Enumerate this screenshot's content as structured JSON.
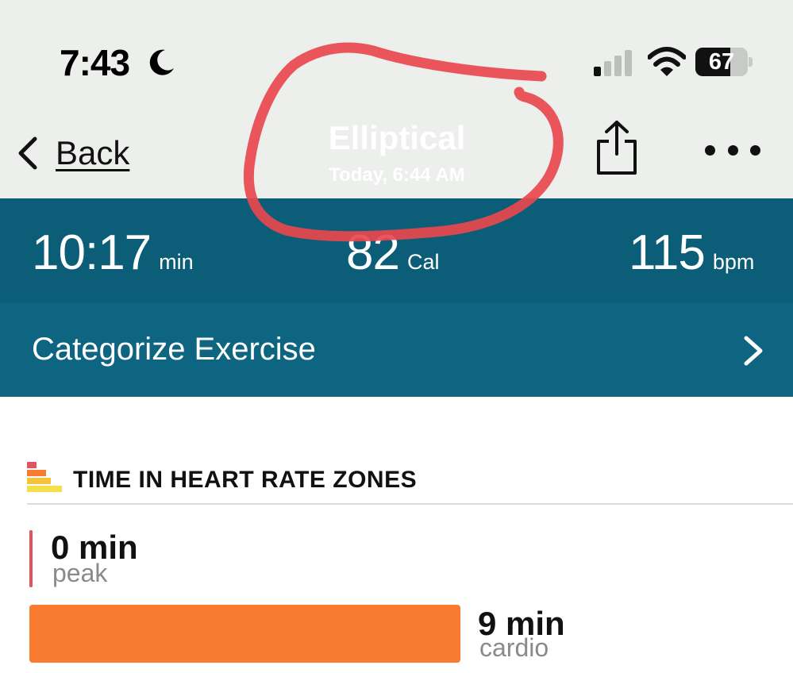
{
  "status_bar": {
    "time": "7:43",
    "focus_icon": "moon-icon",
    "signal_icon": "cellular-signal-icon",
    "wifi_icon": "wifi-icon",
    "battery_percent": "67",
    "battery_level": 0.67
  },
  "nav": {
    "back_label": "Back",
    "title": "Elliptical",
    "subtitle": "Today, 6:44 AM",
    "share_icon": "share-icon",
    "more_icon": "more-icon"
  },
  "stats": {
    "duration": {
      "value": "10:17",
      "unit": "min"
    },
    "calories": {
      "value": "82",
      "unit": "Cal"
    },
    "heart_rate": {
      "value": "115",
      "unit": "bpm"
    }
  },
  "categorize": {
    "label": "Categorize Exercise",
    "chevron_icon": "chevron-right-icon"
  },
  "zones": {
    "title": "TIME IN HEART RATE ZONES",
    "icon": "heart-rate-zones-icon",
    "items": [
      {
        "value": "0 min",
        "label": "peak",
        "minutes": 0
      },
      {
        "value": "9 min",
        "label": "cardio",
        "minutes": 9
      }
    ]
  },
  "colors": {
    "header_bg": "#ecefeb",
    "stats_bg": "#0b5d78",
    "categorize_bg": "#0e6582",
    "peak": "#e0545f",
    "cardio": "#f97b2f",
    "annotation": "#e8484e"
  }
}
